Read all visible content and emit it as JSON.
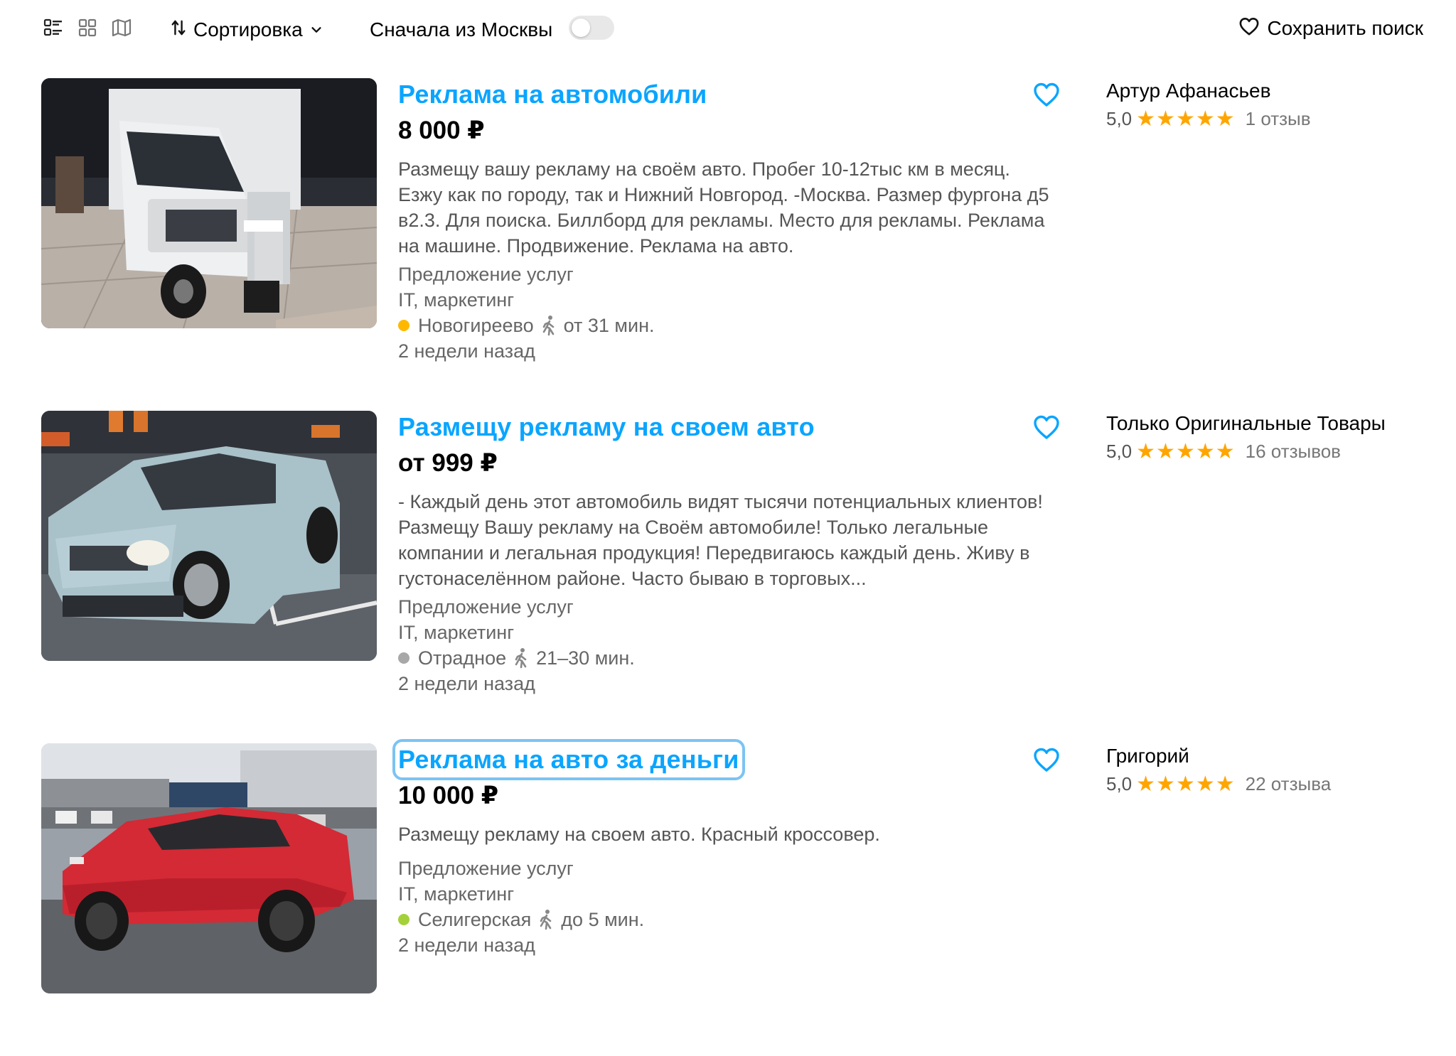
{
  "toolbar": {
    "sort_label": "Сортировка",
    "moscow_label": "Сначала из Москвы",
    "save_search_label": "Сохранить поиск"
  },
  "listings": [
    {
      "title": "Реклама на автомобили",
      "price": "8 000 ₽",
      "description": "Размещу вашу рекламу на своём авто. Пробег 10-12тыс км в месяц. Езжу как по городу, так и Нижний Новгород. -Москва. Размер фургона д5 в2.3. Для поиска. Биллборд для рекламы. Место для рекламы. Реклама на машине. Продвижение. Реклама на авто.",
      "type": "Предложение услуг",
      "category": "IT, маркетинг",
      "station": "Новогиреево",
      "station_color": "#ffb800",
      "walk_time": "от 31 мин.",
      "date": "2 недели назад",
      "seller": "Артур Афанасьев",
      "rating": "5,0",
      "stars": "★★★★★",
      "reviews": "1 отзыв"
    },
    {
      "title": "Размещу рекламу на своем авто",
      "price": "от 999 ₽",
      "description": "- Каждый день этот автомобиль видят тысячи потенциальных клиентов! Размещу Вашу рекламу на Своём автомобиле! Только легальные компании и легальная продукция! Передвигаюсь каждый день. Живу в густонаселённом районе. Часто бываю в торговых...",
      "type": "Предложение услуг",
      "category": "IT, маркетинг",
      "station": "Отрадное",
      "station_color": "#a8a8a8",
      "walk_time": "21–30 мин.",
      "date": "2 недели назад",
      "seller": "Только Оригинальные Товары",
      "rating": "5,0",
      "stars": "★★★★★",
      "reviews": "16 отзывов"
    },
    {
      "title": "Реклама на авто за деньги",
      "price": "10 000 ₽",
      "description": "Размещу рекламу на своем авто. Красный кроссовер.",
      "type": "Предложение услуг",
      "category": "IT, маркетинг",
      "station": "Селигерская",
      "station_color": "#a4d13a",
      "walk_time": "до 5 мин.",
      "date": "2 недели назад",
      "seller": "Григорий",
      "rating": "5,0",
      "stars": "★★★★★",
      "reviews": "22 отзыва"
    }
  ],
  "icons": {
    "list_view": "list-view-icon",
    "grid_view": "grid-view-icon",
    "map_view": "map-view-icon",
    "sort": "sort-arrows-icon",
    "heart": "heart-icon",
    "walk": "pedestrian-icon"
  },
  "colors": {
    "title_link": "#0aa5ff",
    "star": "#ffa500",
    "toggle_off": "#e8e8e8"
  }
}
